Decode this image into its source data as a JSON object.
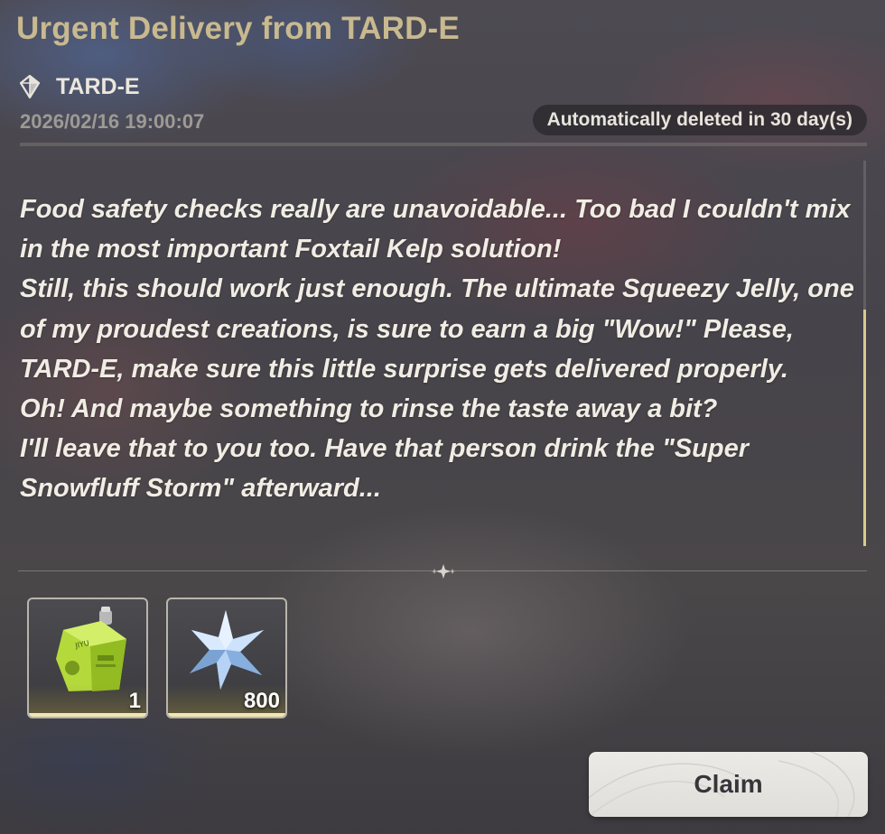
{
  "mail": {
    "title": "Urgent Delivery from TARD-E",
    "sender": "TARD-E",
    "timestamp": "2026/02/16 19:00:07",
    "expiry": "Automatically deleted in 30 day(s)",
    "body": [
      "Food safety checks really are unavoidable... Too bad I couldn't mix in the most important Foxtail Kelp solution!",
      "Still, this should work just enough. The ultimate Squeezy Jelly, one of my proudest creations, is sure to earn a big \"Wow!\" Please, TARD-E, make sure this little surprise gets delivered properly.",
      "Oh! And maybe something to rinse the taste away a bit?",
      "I'll leave that to you too. Have that person drink the \"Super Snowfluff Storm\" afterward..."
    ]
  },
  "rewards": [
    {
      "icon": "squeezy-jelly-pouch-icon",
      "quantity": "1"
    },
    {
      "icon": "crystal-star-icon",
      "quantity": "800"
    }
  ],
  "actions": {
    "claim_label": "Claim"
  },
  "colors": {
    "title": "#c8b98f",
    "accent_scrollbar": "#d9c98a",
    "reward_underline": "#f0e6b2"
  }
}
